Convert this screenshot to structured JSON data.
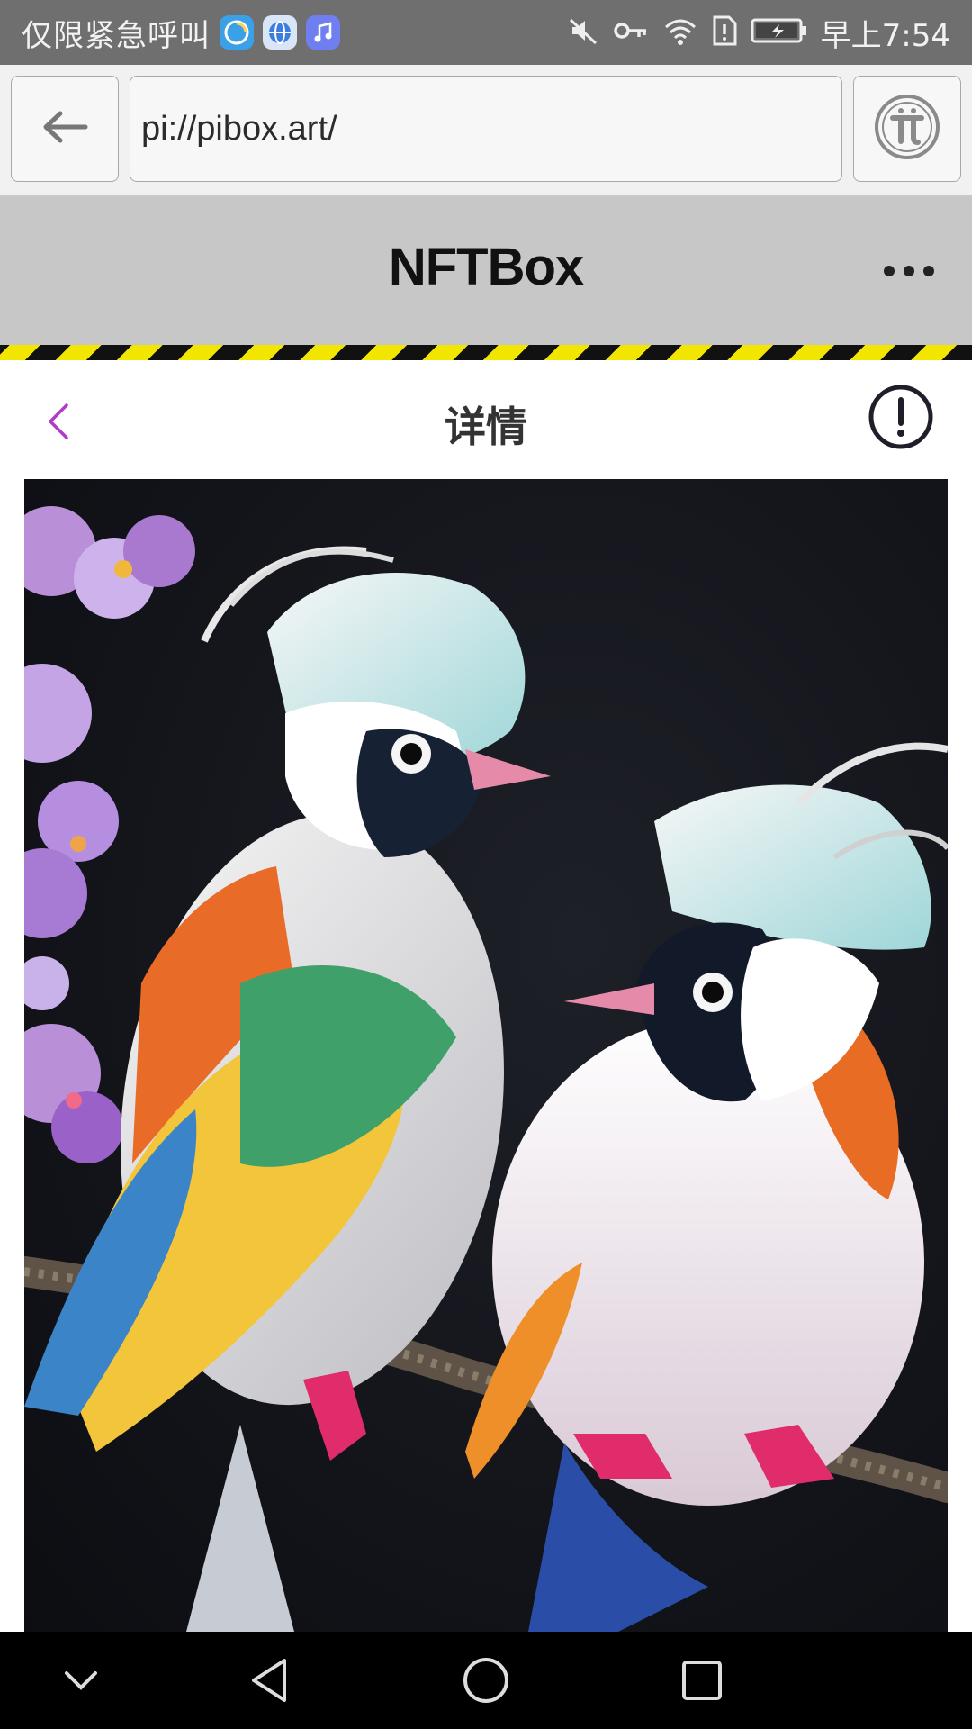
{
  "status_bar": {
    "carrier": "仅限紧急呼叫",
    "time": "早上7:54",
    "app_badges": [
      "swirl-app-icon",
      "globe-app-icon",
      "music-app-icon"
    ],
    "status_icons": [
      "mute-icon",
      "key-icon",
      "wifi-icon",
      "sim-alert-icon",
      "battery-charging-icon"
    ]
  },
  "browser": {
    "url": "pi://pibox.art/",
    "back_icon": "arrow-left-icon",
    "pi_icon": "pi-logo-icon"
  },
  "site": {
    "title": "NFTBox",
    "menu_icon": "more-dots-icon",
    "colors": {
      "header_bg": "#c7c7c7",
      "hazard_yellow": "#f2e600",
      "hazard_black": "#111111"
    }
  },
  "detail": {
    "title": "详情",
    "back_icon": "chevron-left-icon",
    "info_icon": "info-exclamation-icon",
    "accent": "#b03ac9"
  },
  "artwork": {
    "subject": "nft-artwork-image"
  },
  "system_nav": {
    "keys": [
      "chevron-down-icon",
      "back-triangle-icon",
      "home-circle-icon",
      "recents-square-icon"
    ]
  }
}
